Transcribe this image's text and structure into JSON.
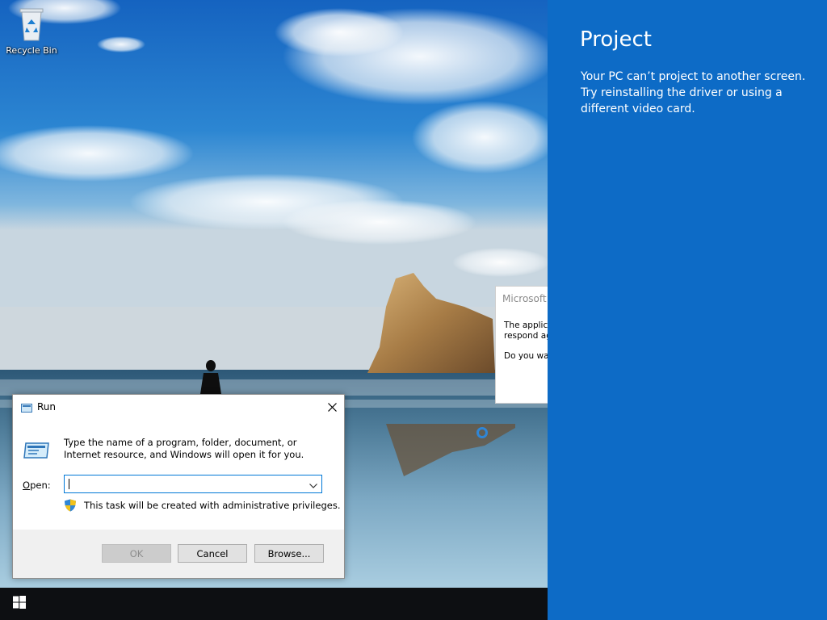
{
  "desktop": {
    "icons": [
      {
        "label": "Recycle Bin",
        "icon": "recycle-bin-icon"
      }
    ]
  },
  "background_dialog": {
    "title": "Microsoft W",
    "body_line1": "The applica",
    "body_line2": "respond ag",
    "question": "Do you war"
  },
  "run_dialog": {
    "title": "Run",
    "description": "Type the name of a program, folder, document, or Internet resource, and Windows will open it for you.",
    "open_label_accel": "O",
    "open_label_rest": "pen:",
    "open_value": "",
    "admin_note": "This task will be created with administrative privileges.",
    "buttons": {
      "ok": "OK",
      "cancel": "Cancel",
      "browse": "Browse..."
    }
  },
  "project_pane": {
    "title": "Project",
    "message": "Your PC can’t project to another screen. Try reinstalling the driver or using a different video card."
  },
  "colors": {
    "project_bg": "#0d6bc6",
    "taskbar_bg": "#0d0f12",
    "accent": "#0078d7"
  }
}
